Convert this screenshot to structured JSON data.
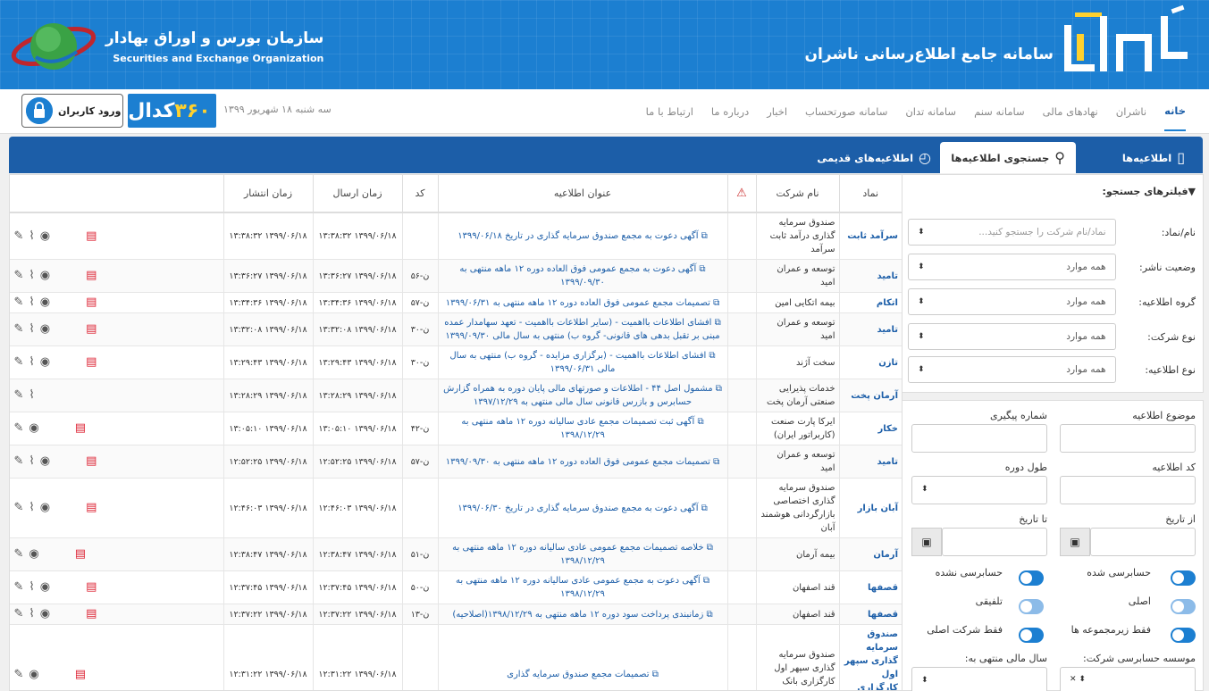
{
  "header": {
    "brand_logo": "کدال",
    "brand_title": "سامانه جامع اطلاع‌رسانی ناشران",
    "seo_fa": "سازمان بورس و اوراق بهادار",
    "seo_en": "Securities and Exchange Organization"
  },
  "nav": {
    "items": [
      "خانه",
      "ناشران",
      "نهادهای مالی",
      "سامانه سنم",
      "سامانه تدان",
      "سامانه صورتحساب",
      "اخبار",
      "درباره ما",
      "ارتباط با ما"
    ],
    "date": "سه شنبه ۱۸ شهریور ۱۳۹۹",
    "codal360_word": "کدال",
    "codal360_num": "۳۶۰",
    "login": "ورود کاربران"
  },
  "tabs": {
    "t1": "اطلاعیه‌ها",
    "t2": "جستجوی اطلاعیه‌ها",
    "t3": "اطلاعیه‌های قدیمی"
  },
  "filters": {
    "title": "فیلترهای جستجو:",
    "symbol_label": "نام/نماد:",
    "symbol_placeholder": "نماد/نام شرکت را جستجو کنید...",
    "publisher_status_label": "وضعیت ناشر:",
    "letter_group_label": "گروه اطلاعیه:",
    "company_type_label": "نوع شرکت:",
    "letter_type_label": "نوع اطلاعیه:",
    "all": "همه موارد"
  },
  "adv": {
    "subject": "موضوع اطلاعیه",
    "tracking": "شماره پیگیری",
    "letter_code": "کد اطلاعیه",
    "period": "طول دوره",
    "from_date": "از تاریخ",
    "to_date": "تا تاریخ",
    "audited": "حسابرسی شده",
    "not_audited": "حسابرسی نشده",
    "main": "اصلی",
    "consolidated": "تلفیقی",
    "only_sub": "فقط زیرمجموعه ها",
    "only_main": "فقط شرکت اصلی",
    "auditor": "موسسه حسابرسی شرکت:",
    "fiscal_year": "سال مالی منتهی به:"
  },
  "table": {
    "headers": {
      "symbol": "نماد",
      "company": "نام شرکت",
      "title": "عنوان اطلاعیه",
      "code": "کد",
      "sent": "زمان ارسال",
      "published": "زمان انتشار"
    },
    "rows": [
      {
        "symbol": "سرآمد ثابت",
        "company": "صندوق سرمایه گذاری درآمد ثابت سرآمد",
        "title": "آگهی دعوت به مجمع صندوق سرمایه گذاری در تاریخ ۱۳۹۹/۰۶/۱۸",
        "code": "",
        "sent": "۱۳۹۹/۰۶/۱۸ ۱۳:۳۸:۳۲",
        "published": "۱۳۹۹/۰۶/۱۸ ۱۳:۳۸:۳۲"
      },
      {
        "symbol": "تامید",
        "company": "توسعه و عمران امید",
        "title": "آگهی دعوت به مجمع عمومی فوق العاده دوره ۱۲ ماهه منتهی به ۱۳۹۹/۰۹/۳۰",
        "code": "ن-۵۶",
        "sent": "۱۳۹۹/۰۶/۱۸ ۱۳:۳۶:۲۷",
        "published": "۱۳۹۹/۰۶/۱۸ ۱۳:۳۶:۲۷"
      },
      {
        "symbol": "اتکام",
        "company": "بیمه اتکایی امین",
        "title": "تصمیمات مجمع عمومی فوق العاده دوره ۱۲ ماهه منتهی به ۱۳۹۹/۰۶/۳۱",
        "code": "ن-۵۷",
        "sent": "۱۳۹۹/۰۶/۱۸ ۱۳:۳۴:۳۶",
        "published": "۱۳۹۹/۰۶/۱۸ ۱۳:۳۴:۳۶"
      },
      {
        "symbol": "تامید",
        "company": "توسعه و عمران امید",
        "title": "افشای اطلاعات بااهمیت - (سایر اطلاعات بااهمیت - تعهد سهامدار عمده مبنی بر تقبل بدهی های قانونی- گروه ب) منتهی به سال مالی ۱۳۹۹/۰۹/۳۰",
        "code": "ن-۳۰",
        "sent": "۱۳۹۹/۰۶/۱۸ ۱۳:۳۲:۰۸",
        "published": "۱۳۹۹/۰۶/۱۸ ۱۳:۳۲:۰۸"
      },
      {
        "symbol": "تازن",
        "company": "سخت آژند",
        "title": "افشای اطلاعات بااهمیت - (برگزاری مزایده - گروه ب) منتهی به سال مالی ۱۳۹۹/۰۶/۳۱",
        "code": "ن-۳۰",
        "sent": "۱۳۹۹/۰۶/۱۸ ۱۳:۲۹:۴۳",
        "published": "۱۳۹۹/۰۶/۱۸ ۱۳:۲۹:۴۳"
      },
      {
        "symbol": "آرمان پخت",
        "company": "خدمات پذیرایی صنعتی آرمان پخت",
        "title": "مشمول اصل ۴۴ - اطلاعات و صورتهای مالی پایان دوره به همراه گزارش حسابرس و بازرس قانونی سال مالی منتهی به ۱۳۹۷/۱۲/۲۹",
        "code": "",
        "sent": "۱۳۹۹/۰۶/۱۸ ۱۳:۲۸:۲۹",
        "published": "۱۳۹۹/۰۶/۱۸ ۱۳:۲۸:۲۹"
      },
      {
        "symbol": "خکار",
        "company": "ایرکا پارت صنعت (کاربراتور ایران)",
        "title": "آگهی ثبت تصمیمات مجمع عادی سالیانه دوره ۱۲ ماهه منتهی به ۱۳۹۸/۱۲/۲۹",
        "code": "ن-۴۲",
        "sent": "۱۳۹۹/۰۶/۱۸ ۱۳:۰۵:۱۰",
        "published": "۱۳۹۹/۰۶/۱۸ ۱۳:۰۵:۱۰"
      },
      {
        "symbol": "تامید",
        "company": "توسعه و عمران امید",
        "title": "تصمیمات مجمع عمومی فوق العاده دوره ۱۲ ماهه منتهی به ۱۳۹۹/۰۹/۳۰",
        "code": "ن-۵۷",
        "sent": "۱۳۹۹/۰۶/۱۸ ۱۲:۵۲:۲۵",
        "published": "۱۳۹۹/۰۶/۱۸ ۱۲:۵۲:۲۵"
      },
      {
        "symbol": "آبان بازار",
        "company": "صندوق سرمایه گذاری اختصاصی بازارگردانی هوشمند آبان",
        "title": "آگهی دعوت به مجمع صندوق سرمایه گذاری در تاریخ ۱۳۹۹/۰۶/۳۰",
        "code": "",
        "sent": "۱۳۹۹/۰۶/۱۸ ۱۲:۴۶:۰۳",
        "published": "۱۳۹۹/۰۶/۱۸ ۱۲:۴۶:۰۳"
      },
      {
        "symbol": "آرمان",
        "company": "بیمه آرمان",
        "title": "خلاصه تصمیمات مجمع عمومی عادی سالیانه دوره ۱۲ ماهه منتهی به ۱۳۹۸/۱۲/۲۹",
        "code": "ن-۵۱",
        "sent": "۱۳۹۹/۰۶/۱۸ ۱۲:۳۸:۴۷",
        "published": "۱۳۹۹/۰۶/۱۸ ۱۲:۳۸:۴۷"
      },
      {
        "symbol": "قصفها",
        "company": "قند اصفهان",
        "title": "آگهی دعوت به مجمع عمومی عادی سالیانه دوره ۱۲ ماهه منتهی به ۱۳۹۸/۱۲/۲۹",
        "code": "ن-۵۰",
        "sent": "۱۳۹۹/۰۶/۱۸ ۱۲:۳۷:۴۵",
        "published": "۱۳۹۹/۰۶/۱۸ ۱۲:۳۷:۴۵"
      },
      {
        "symbol": "قصفها",
        "company": "قند اصفهان",
        "title": "زمانبندی پرداخت سود دوره ۱۲ ماهه منتهی به ۱۳۹۸/۱۲/۲۹(اصلاحیه)",
        "code": "ن-۱۳",
        "sent": "۱۳۹۹/۰۶/۱۸ ۱۲:۳۷:۲۲",
        "published": "۱۳۹۹/۰۶/۱۸ ۱۲:۳۷:۲۲"
      },
      {
        "symbol": "صندوق سرمایه گذاری سپهر اول کارگزاری بانک صادرات",
        "company": "صندوق سرمایه گذاری سپهر اول کارگزاری بانک صادرات",
        "title": "تصمیمات مجمع صندوق سرمایه گذاری",
        "code": "",
        "sent": "۱۳۹۹/۰۶/۱۸ ۱۲:۳۱:۲۲",
        "published": "۱۳۹۹/۰۶/۱۸ ۱۲:۳۱:۲۲"
      }
    ]
  }
}
